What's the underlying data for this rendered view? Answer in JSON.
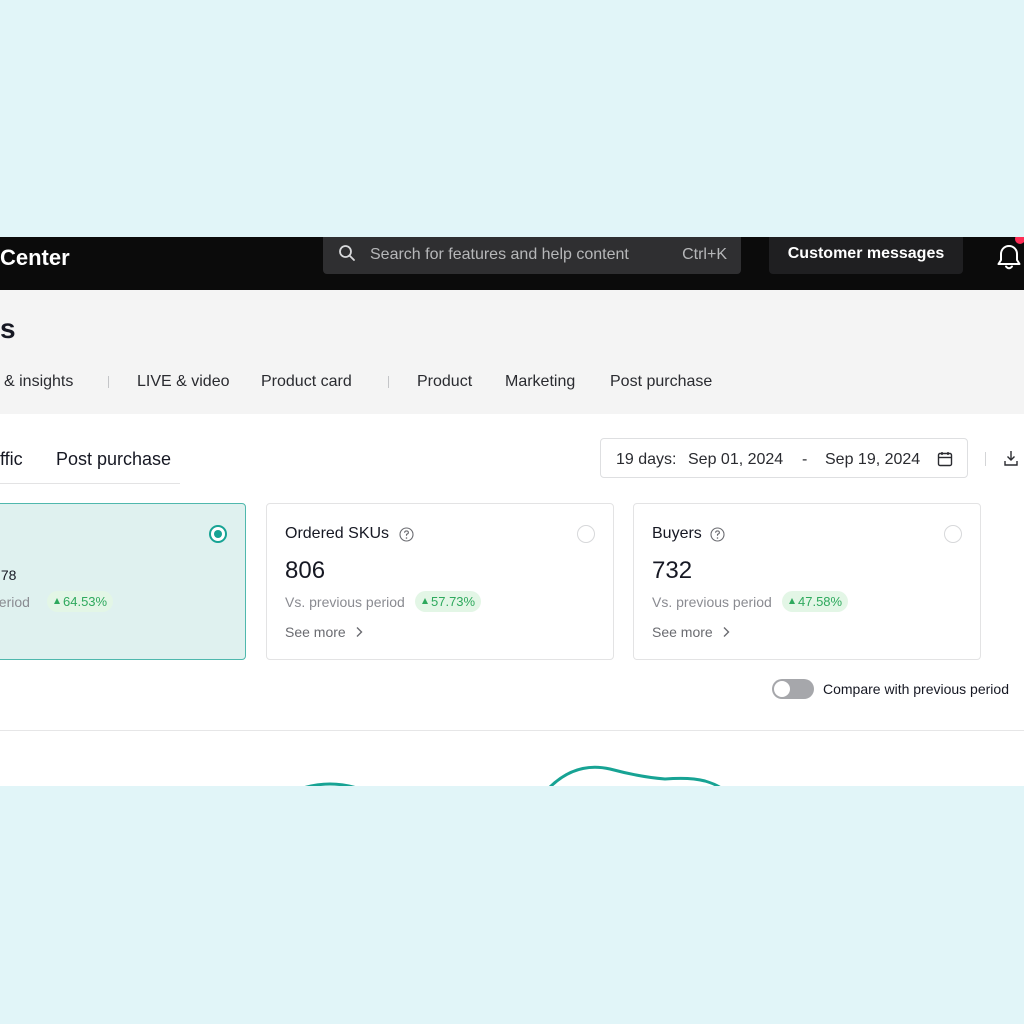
{
  "app": {
    "brand": "Center"
  },
  "search": {
    "placeholder": "Search for features and help content",
    "shortcut": "Ctrl+K"
  },
  "topbar": {
    "customer_messages": "Customer messages"
  },
  "page": {
    "title": "s"
  },
  "nav": {
    "items": [
      {
        "label": "& insights"
      },
      {
        "label": "LIVE & video"
      },
      {
        "label": "Product card"
      },
      {
        "label": "Product"
      },
      {
        "label": "Marketing"
      },
      {
        "label": "Post purchase"
      }
    ]
  },
  "subtabs": [
    {
      "label": "ffic"
    },
    {
      "label": "Post purchase"
    }
  ],
  "date_range": {
    "label": "19 days:",
    "start": "Sep 01, 2024",
    "separator": "-",
    "end": "Sep 19, 2024"
  },
  "cards": [
    {
      "title": "",
      "value": ".78",
      "vs": "period",
      "change": "64.53%",
      "selected": true
    },
    {
      "title": "Ordered SKUs",
      "value": "806",
      "vs": "Vs. previous period",
      "change": "57.73%",
      "see_more": "See more",
      "selected": false
    },
    {
      "title": "Buyers",
      "value": "732",
      "vs": "Vs. previous period",
      "change": "47.58%",
      "see_more": "See more",
      "selected": false
    }
  ],
  "compare": {
    "label": "Compare with previous period",
    "enabled": false
  },
  "colors": {
    "accent": "#17a394",
    "positive": "#2ea95d",
    "topbar": "#0b0b0b",
    "background": "#e1f5f8",
    "notification": "#fe2c55"
  },
  "icons": {
    "search": "search-icon",
    "bell": "bell-icon",
    "calendar": "calendar-icon",
    "download": "download-icon",
    "help": "help-icon",
    "chevron": "chevron-right-icon"
  }
}
